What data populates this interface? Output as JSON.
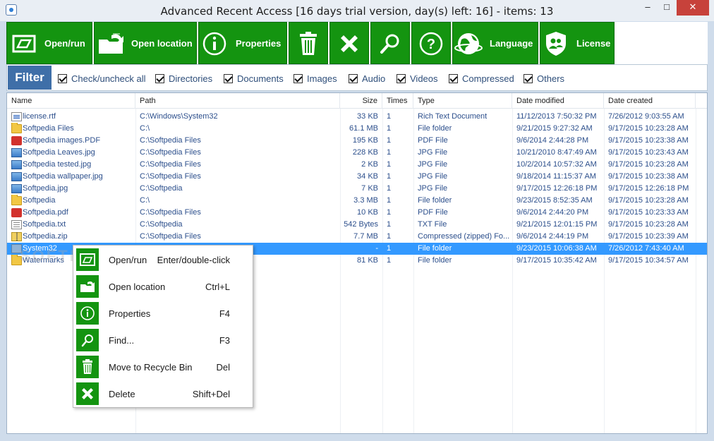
{
  "window": {
    "title": "Advanced Recent Access [16 days trial version,  day(s) left: 16] - items: 13",
    "min": "–",
    "max": "□",
    "close": "✕"
  },
  "toolbar": {
    "open_run": "Open/run",
    "open_location": "Open location",
    "properties": "Properties",
    "language": "Language",
    "license": "License"
  },
  "filter": {
    "title": "Filter",
    "options": [
      "Check/uncheck all",
      "Directories",
      "Documents",
      "Images",
      "Audio",
      "Videos",
      "Compressed",
      "Others"
    ]
  },
  "table": {
    "columns": [
      "Name",
      "Path",
      "Size",
      "Times",
      "Type",
      "Date modified",
      "Date created"
    ],
    "rows": [
      {
        "icon": "rtf",
        "name": "license.rtf",
        "path": "C:\\Windows\\System32",
        "size": "33 KB",
        "times": "1",
        "type": "Rich Text Document",
        "modified": "11/12/2013 7:50:32 PM",
        "created": "7/26/2012 9:03:55 AM"
      },
      {
        "icon": "folder",
        "name": "Softpedia Files",
        "path": "C:\\",
        "size": "61.1 MB",
        "times": "1",
        "type": "File folder",
        "modified": "9/21/2015 9:27:32 AM",
        "created": "9/17/2015 10:23:28 AM"
      },
      {
        "icon": "pdf",
        "name": "Softpedia images.PDF",
        "path": "C:\\Softpedia Files",
        "size": "195 KB",
        "times": "1",
        "type": "PDF File",
        "modified": "9/6/2014 2:44:28 PM",
        "created": "9/17/2015 10:23:38 AM"
      },
      {
        "icon": "img",
        "name": "Softpedia Leaves.jpg",
        "path": "C:\\Softpedia Files",
        "size": "228 KB",
        "times": "1",
        "type": "JPG File",
        "modified": "10/21/2010 8:47:49 AM",
        "created": "9/17/2015 10:23:43 AM"
      },
      {
        "icon": "img",
        "name": "Softpedia tested.jpg",
        "path": "C:\\Softpedia Files",
        "size": "2 KB",
        "times": "1",
        "type": "JPG File",
        "modified": "10/2/2014 10:57:32 AM",
        "created": "9/17/2015 10:23:28 AM"
      },
      {
        "icon": "img",
        "name": "Softpedia wallpaper.jpg",
        "path": "C:\\Softpedia Files",
        "size": "34 KB",
        "times": "1",
        "type": "JPG File",
        "modified": "9/18/2014 11:15:37 AM",
        "created": "9/17/2015 10:23:38 AM"
      },
      {
        "icon": "img",
        "name": "Softpedia.jpg",
        "path": "C:\\Softpedia",
        "size": "7 KB",
        "times": "1",
        "type": "JPG File",
        "modified": "9/17/2015 12:26:18 PM",
        "created": "9/17/2015 12:26:18 PM"
      },
      {
        "icon": "folder",
        "name": "Softpedia",
        "path": "C:\\",
        "size": "3.3 MB",
        "times": "1",
        "type": "File folder",
        "modified": "9/23/2015 8:52:35 AM",
        "created": "9/17/2015 10:23:28 AM"
      },
      {
        "icon": "pdf",
        "name": "Softpedia.pdf",
        "path": "C:\\Softpedia Files",
        "size": "10 KB",
        "times": "1",
        "type": "PDF File",
        "modified": "9/6/2014 2:44:20 PM",
        "created": "9/17/2015 10:23:33 AM"
      },
      {
        "icon": "txt",
        "name": "Softpedia.txt",
        "path": "C:\\Softpedia",
        "size": "542 Bytes",
        "times": "1",
        "type": "TXT File",
        "modified": "9/21/2015 12:01:15 PM",
        "created": "9/17/2015 10:23:28 AM"
      },
      {
        "icon": "zip",
        "name": "Softpedia.zip",
        "path": "C:\\Softpedia Files",
        "size": "7.7 MB",
        "times": "1",
        "type": "Compressed (zipped) Fo...",
        "modified": "9/6/2014 2:44:19 PM",
        "created": "9/17/2015 10:23:39 AM"
      },
      {
        "icon": "sysfolder",
        "name": "System32",
        "path": "",
        "size": "-",
        "times": "1",
        "type": "File folder",
        "modified": "9/23/2015 10:06:38 AM",
        "created": "7/26/2012 7:43:40 AM",
        "selected": true
      },
      {
        "icon": "folder",
        "name": "Watermarks",
        "path": "",
        "size": "81 KB",
        "times": "1",
        "type": "File folder",
        "modified": "9/17/2015 10:35:42 AM",
        "created": "9/17/2015 10:34:57 AM"
      }
    ]
  },
  "context_menu": {
    "items": [
      {
        "label": "Open/run",
        "shortcut": "Enter/double-click"
      },
      {
        "label": "Open location",
        "shortcut": "Ctrl+L"
      },
      {
        "label": "Properties",
        "shortcut": "F4"
      },
      {
        "label": "Find...",
        "shortcut": "F3"
      },
      {
        "label": "Move to Recycle Bin",
        "shortcut": "Del"
      },
      {
        "label": "Delete",
        "shortcut": "Shift+Del"
      }
    ]
  },
  "colors": {
    "accent_green": "#149410",
    "filter_blue": "#3f6fa8",
    "selection_blue": "#3399ff",
    "text_link_blue": "#2c4f8c"
  }
}
